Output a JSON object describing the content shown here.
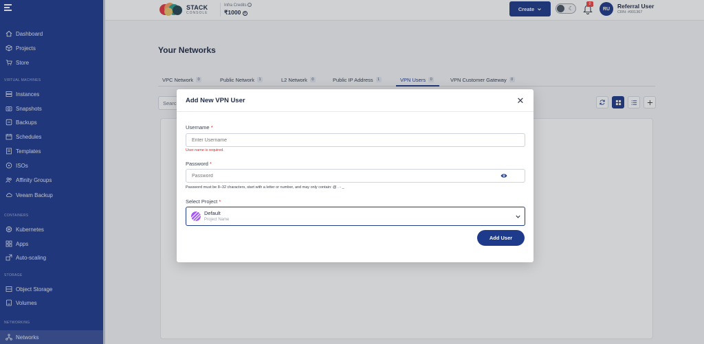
{
  "sidebar": {
    "items": [
      {
        "label": "Dashboard",
        "icon": "home-icon"
      },
      {
        "label": "Projects",
        "icon": "cube-icon"
      },
      {
        "label": "Store",
        "icon": "cart-icon"
      },
      {
        "label": "Instances",
        "icon": "server-icon"
      },
      {
        "label": "Snapshots",
        "icon": "camera-icon"
      },
      {
        "label": "Backups",
        "icon": "backup-icon"
      },
      {
        "label": "Schedules",
        "icon": "calendar-icon"
      },
      {
        "label": "Templates",
        "icon": "template-icon"
      },
      {
        "label": "ISOs",
        "icon": "disk-icon"
      },
      {
        "label": "Affinity Groups",
        "icon": "group-icon"
      },
      {
        "label": "Veeam Backup",
        "icon": "cloud-icon"
      },
      {
        "label": "Kubernetes",
        "icon": "kubernetes-icon"
      },
      {
        "label": "Apps",
        "icon": "apps-icon"
      },
      {
        "label": "Auto-scaling",
        "icon": "scale-icon"
      },
      {
        "label": "Object Storage",
        "icon": "storage-icon"
      },
      {
        "label": "Volumes",
        "icon": "volume-icon"
      },
      {
        "label": "Networks",
        "icon": "network-icon"
      }
    ],
    "sections": {
      "virtual_machines": "VIRTUAL MACHINES",
      "containers": "CONTAINERS",
      "storage": "STORAGE",
      "networking": "NETWORKING"
    }
  },
  "header": {
    "logo_text": "STACK",
    "logo_sub": "CONSOLE",
    "credits_label": "Infra Credits",
    "credits_value": "₹1000",
    "create_label": "Create",
    "notification_count": "0",
    "avatar_initials": "RU",
    "user_name": "Referral User",
    "user_id": "CRN: #001367"
  },
  "main": {
    "title": "Your Networks",
    "tabs": [
      {
        "label": "VPC Network",
        "count": "0"
      },
      {
        "label": "Public Network",
        "count": "1"
      },
      {
        "label": "L2 Network",
        "count": "0"
      },
      {
        "label": "Public IP Address",
        "count": "1"
      },
      {
        "label": "VPN Users",
        "count": "0"
      },
      {
        "label": "VPN Customer Gateway",
        "count": "0"
      }
    ],
    "active_tab": "VPN Users",
    "search_placeholder": "Search"
  },
  "modal": {
    "title": "Add New VPN User",
    "username": {
      "label": "Username",
      "required_mark": "*",
      "placeholder": "Enter Username",
      "value": "",
      "error": "User name is required."
    },
    "password": {
      "label": "Password",
      "required_mark": "*",
      "placeholder": "Password",
      "value": "",
      "hint": "Password must be 8–32 characters, start with a letter or number, and may only contain: @ . - _"
    },
    "project": {
      "label": "Select Project",
      "required_mark": "*",
      "selected_name": "Default",
      "selected_sub": "Project Name"
    },
    "submit_label": "Add User"
  },
  "colors": {
    "sidebar": "#1f3a8f",
    "primary": "#1e3a8a",
    "error": "#dc2626",
    "background": "#f4f5f7"
  }
}
